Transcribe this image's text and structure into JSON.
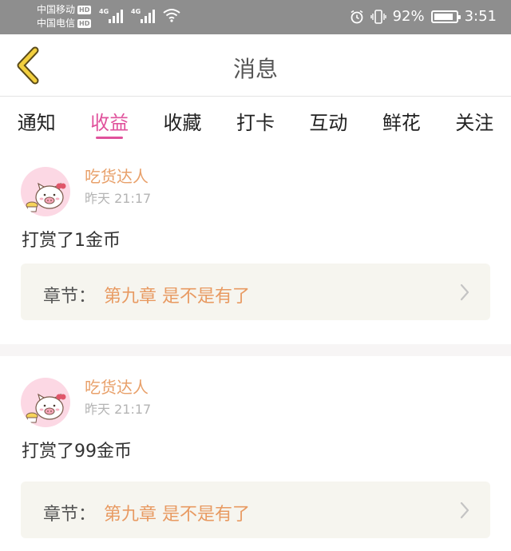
{
  "status_bar": {
    "carrier_1": "中国移动",
    "carrier_2": "中国电信",
    "hd_badge": "HD",
    "network_1": "4G",
    "network_2": "4G",
    "battery_percent": "92%",
    "battery_level": 0.92,
    "time": "3:51"
  },
  "header": {
    "title": "消息",
    "back_icon": "chevron-left-icon"
  },
  "tabs": [
    {
      "label": "通知",
      "active": false
    },
    {
      "label": "收益",
      "active": true
    },
    {
      "label": "收藏",
      "active": false
    },
    {
      "label": "打卡",
      "active": false
    },
    {
      "label": "互动",
      "active": false
    },
    {
      "label": "鲜花",
      "active": false
    },
    {
      "label": "关注",
      "active": false
    }
  ],
  "colors": {
    "accent": "#e0529c",
    "username": "#e8a06a",
    "chapter_title": "#e89a62",
    "chapter_bg": "#f6f5ef"
  },
  "messages": [
    {
      "username": "吃货达人",
      "time": "昨天 21:17",
      "text": "打赏了1金币",
      "chapter_label": "章节：",
      "chapter_title": "第九章 是不是有了"
    },
    {
      "username": "吃货达人",
      "time": "昨天 21:17",
      "text": "打赏了99金币",
      "chapter_label": "章节：",
      "chapter_title": "第九章 是不是有了"
    }
  ]
}
